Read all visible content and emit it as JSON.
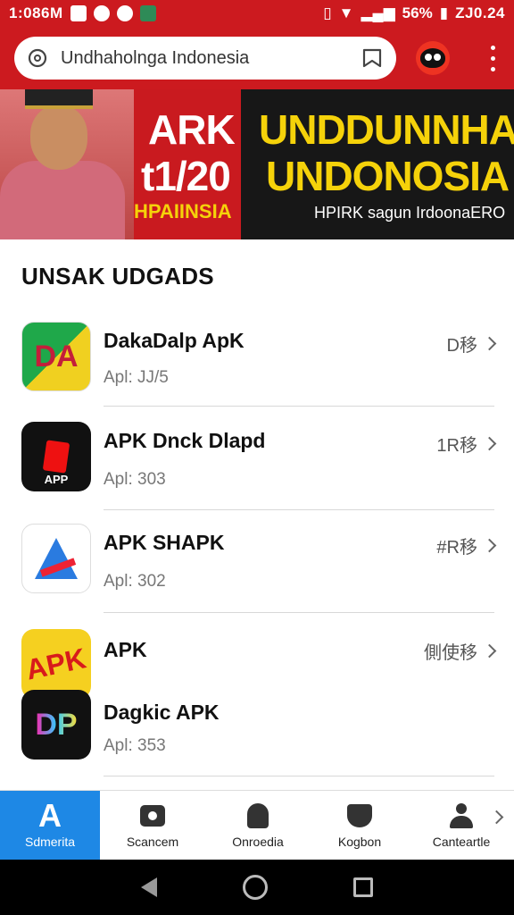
{
  "status_bar": {
    "time": "1:086M",
    "battery": "56%",
    "clock_right": "ZJ0.24"
  },
  "browser": {
    "url": "Undhaholnga Indonesia"
  },
  "banner": {
    "line1": "ARK",
    "line2": "t1/20",
    "line3": "HPAIINSIA",
    "title1": "UNDDUNNHAN",
    "title2": "UNDONOSIA",
    "tagline": "HPIRK sagun IrdoonaERO"
  },
  "section": {
    "title": "UNSAK UDGADS"
  },
  "apps": [
    {
      "name": "DakaDalp ApK",
      "sub": "Apl: JJ/5",
      "meta": "D移",
      "icon": "DA"
    },
    {
      "name": "APK Dnck Dlapd",
      "sub": "Apl: 303",
      "meta": "1R移",
      "icon": "APP"
    },
    {
      "name": "APK SHAPK",
      "sub": "Apl: 302",
      "meta": "#R移",
      "icon": "sha"
    },
    {
      "name": "APK",
      "sub": "",
      "meta": "側使移",
      "icon": "APK"
    },
    {
      "name": "Dagkic APK",
      "sub": "Apl: 353",
      "meta": "",
      "icon": "DP"
    }
  ],
  "bottom_nav": [
    {
      "label": "Sdmerita",
      "icon": "A"
    },
    {
      "label": "Scancem",
      "icon": "camera-icon"
    },
    {
      "label": "Onroedia",
      "icon": "bell-icon"
    },
    {
      "label": "Kogbon",
      "icon": "shield-icon"
    },
    {
      "label": "Canteartle",
      "icon": "person-icon"
    }
  ],
  "colors": {
    "brand_red": "#cc1a1f",
    "active_nav": "#1e88e5",
    "banner_yellow": "#f5d20a"
  }
}
